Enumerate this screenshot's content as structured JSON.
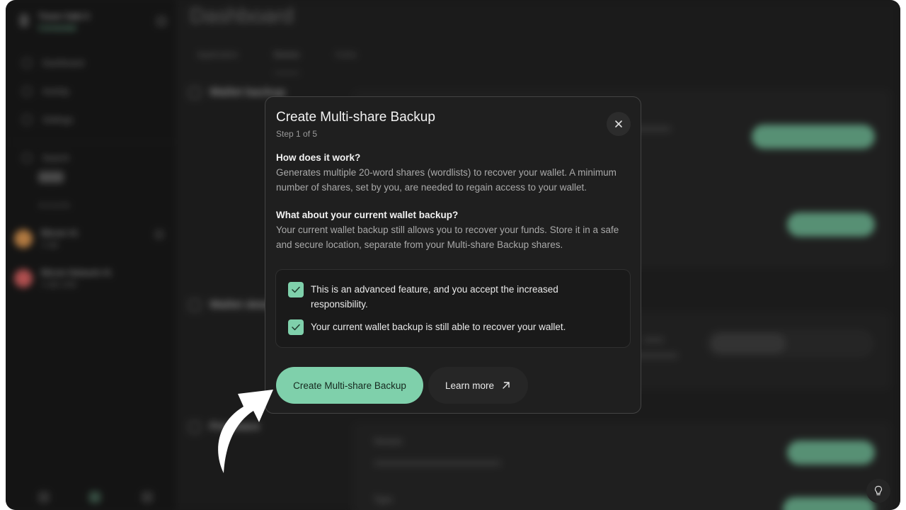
{
  "sidebar": {
    "profile": {
      "name": "Trezor Safe 5",
      "status": "Connected"
    },
    "nav": [
      {
        "label": "Dashboard",
        "icon": "home-icon"
      },
      {
        "label": "Activity",
        "icon": "clock-icon"
      },
      {
        "label": "Settings",
        "icon": "gear-icon"
      }
    ],
    "search_label": "Search",
    "section_label": "Accounts",
    "wallets": [
      {
        "name": "Bitcoin #1",
        "sub": "1 tab",
        "color": "#c98a4a"
      },
      {
        "name": "Bitcoin Network #1",
        "sub": "1 tab USD",
        "color": "#c75a5a"
      }
    ]
  },
  "main": {
    "title": "Dashboard",
    "tabs": [
      {
        "label": "Application",
        "active": false
      },
      {
        "label": "Device",
        "active": true
      },
      {
        "label": "Coins",
        "active": false
      }
    ],
    "sections": [
      {
        "label": "Wallet backup"
      },
      {
        "label": "Wallet details"
      },
      {
        "label": "Firmware"
      }
    ],
    "card_labels": {
      "version": "Version",
      "type": "Type"
    },
    "segment": {
      "a": "Standard",
      "b": "Passphrase"
    }
  },
  "modal": {
    "title": "Create Multi-share Backup",
    "step": "Step 1 of 5",
    "q1": "How does it work?",
    "p1": "Generates multiple 20-word shares (wordlists) to recover your wallet. A minimum number of shares, set by you, are needed to regain access to your wallet.",
    "q2": "What about your current wallet backup?",
    "p2": "Your current wallet backup still allows you to recover your funds. Store it in a safe and secure location, separate from your Multi-share Backup shares.",
    "checks": [
      {
        "text": "This is an advanced feature, and you accept the increased responsibility.",
        "checked": true
      },
      {
        "text": "Your current wallet backup is still able to recover your wallet.",
        "checked": true
      }
    ],
    "primary_label": "Create Multi-share Backup",
    "secondary_label": "Learn more",
    "close_icon": "close-icon",
    "external_icon": "arrow-up-right-icon"
  },
  "colors": {
    "accent": "#7fd0ab",
    "modal_bg": "#1f1f1f",
    "app_bg": "#1c1c1c"
  }
}
